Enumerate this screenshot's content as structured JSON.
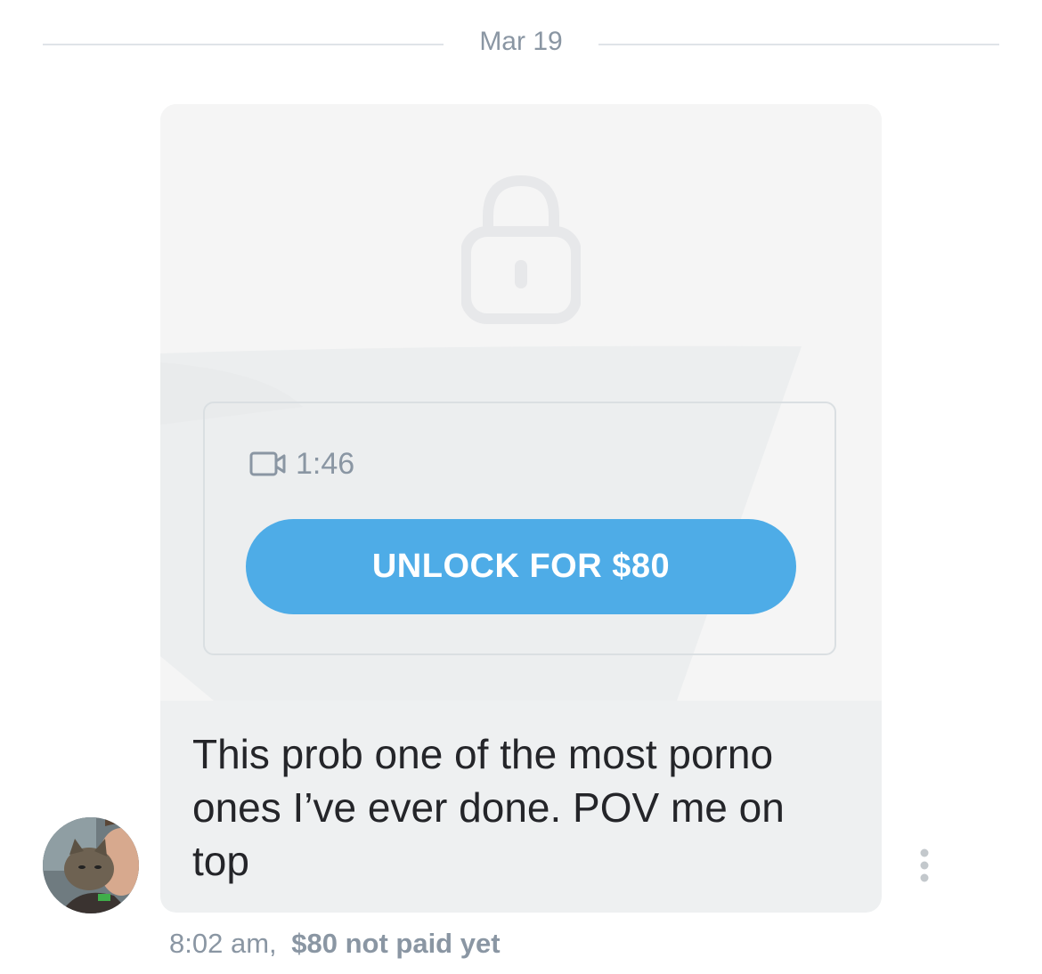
{
  "date_divider": {
    "label": "Mar 19"
  },
  "message": {
    "media": {
      "lock_icon": "lock-icon",
      "camera_icon": "video-camera-icon",
      "duration": "1:46",
      "unlock_label": "UNLOCK FOR $80"
    },
    "text": "This prob one of the most porno ones I’ve ever done. POV me on top",
    "time": "8:02 am,",
    "payment_status": "$80 not paid yet",
    "more_icon": "more-vertical-icon"
  },
  "colors": {
    "accent": "#4eace7",
    "muted_text": "#8a96a3",
    "bubble_bg": "#eef0f1",
    "media_bg": "#f5f5f5"
  }
}
